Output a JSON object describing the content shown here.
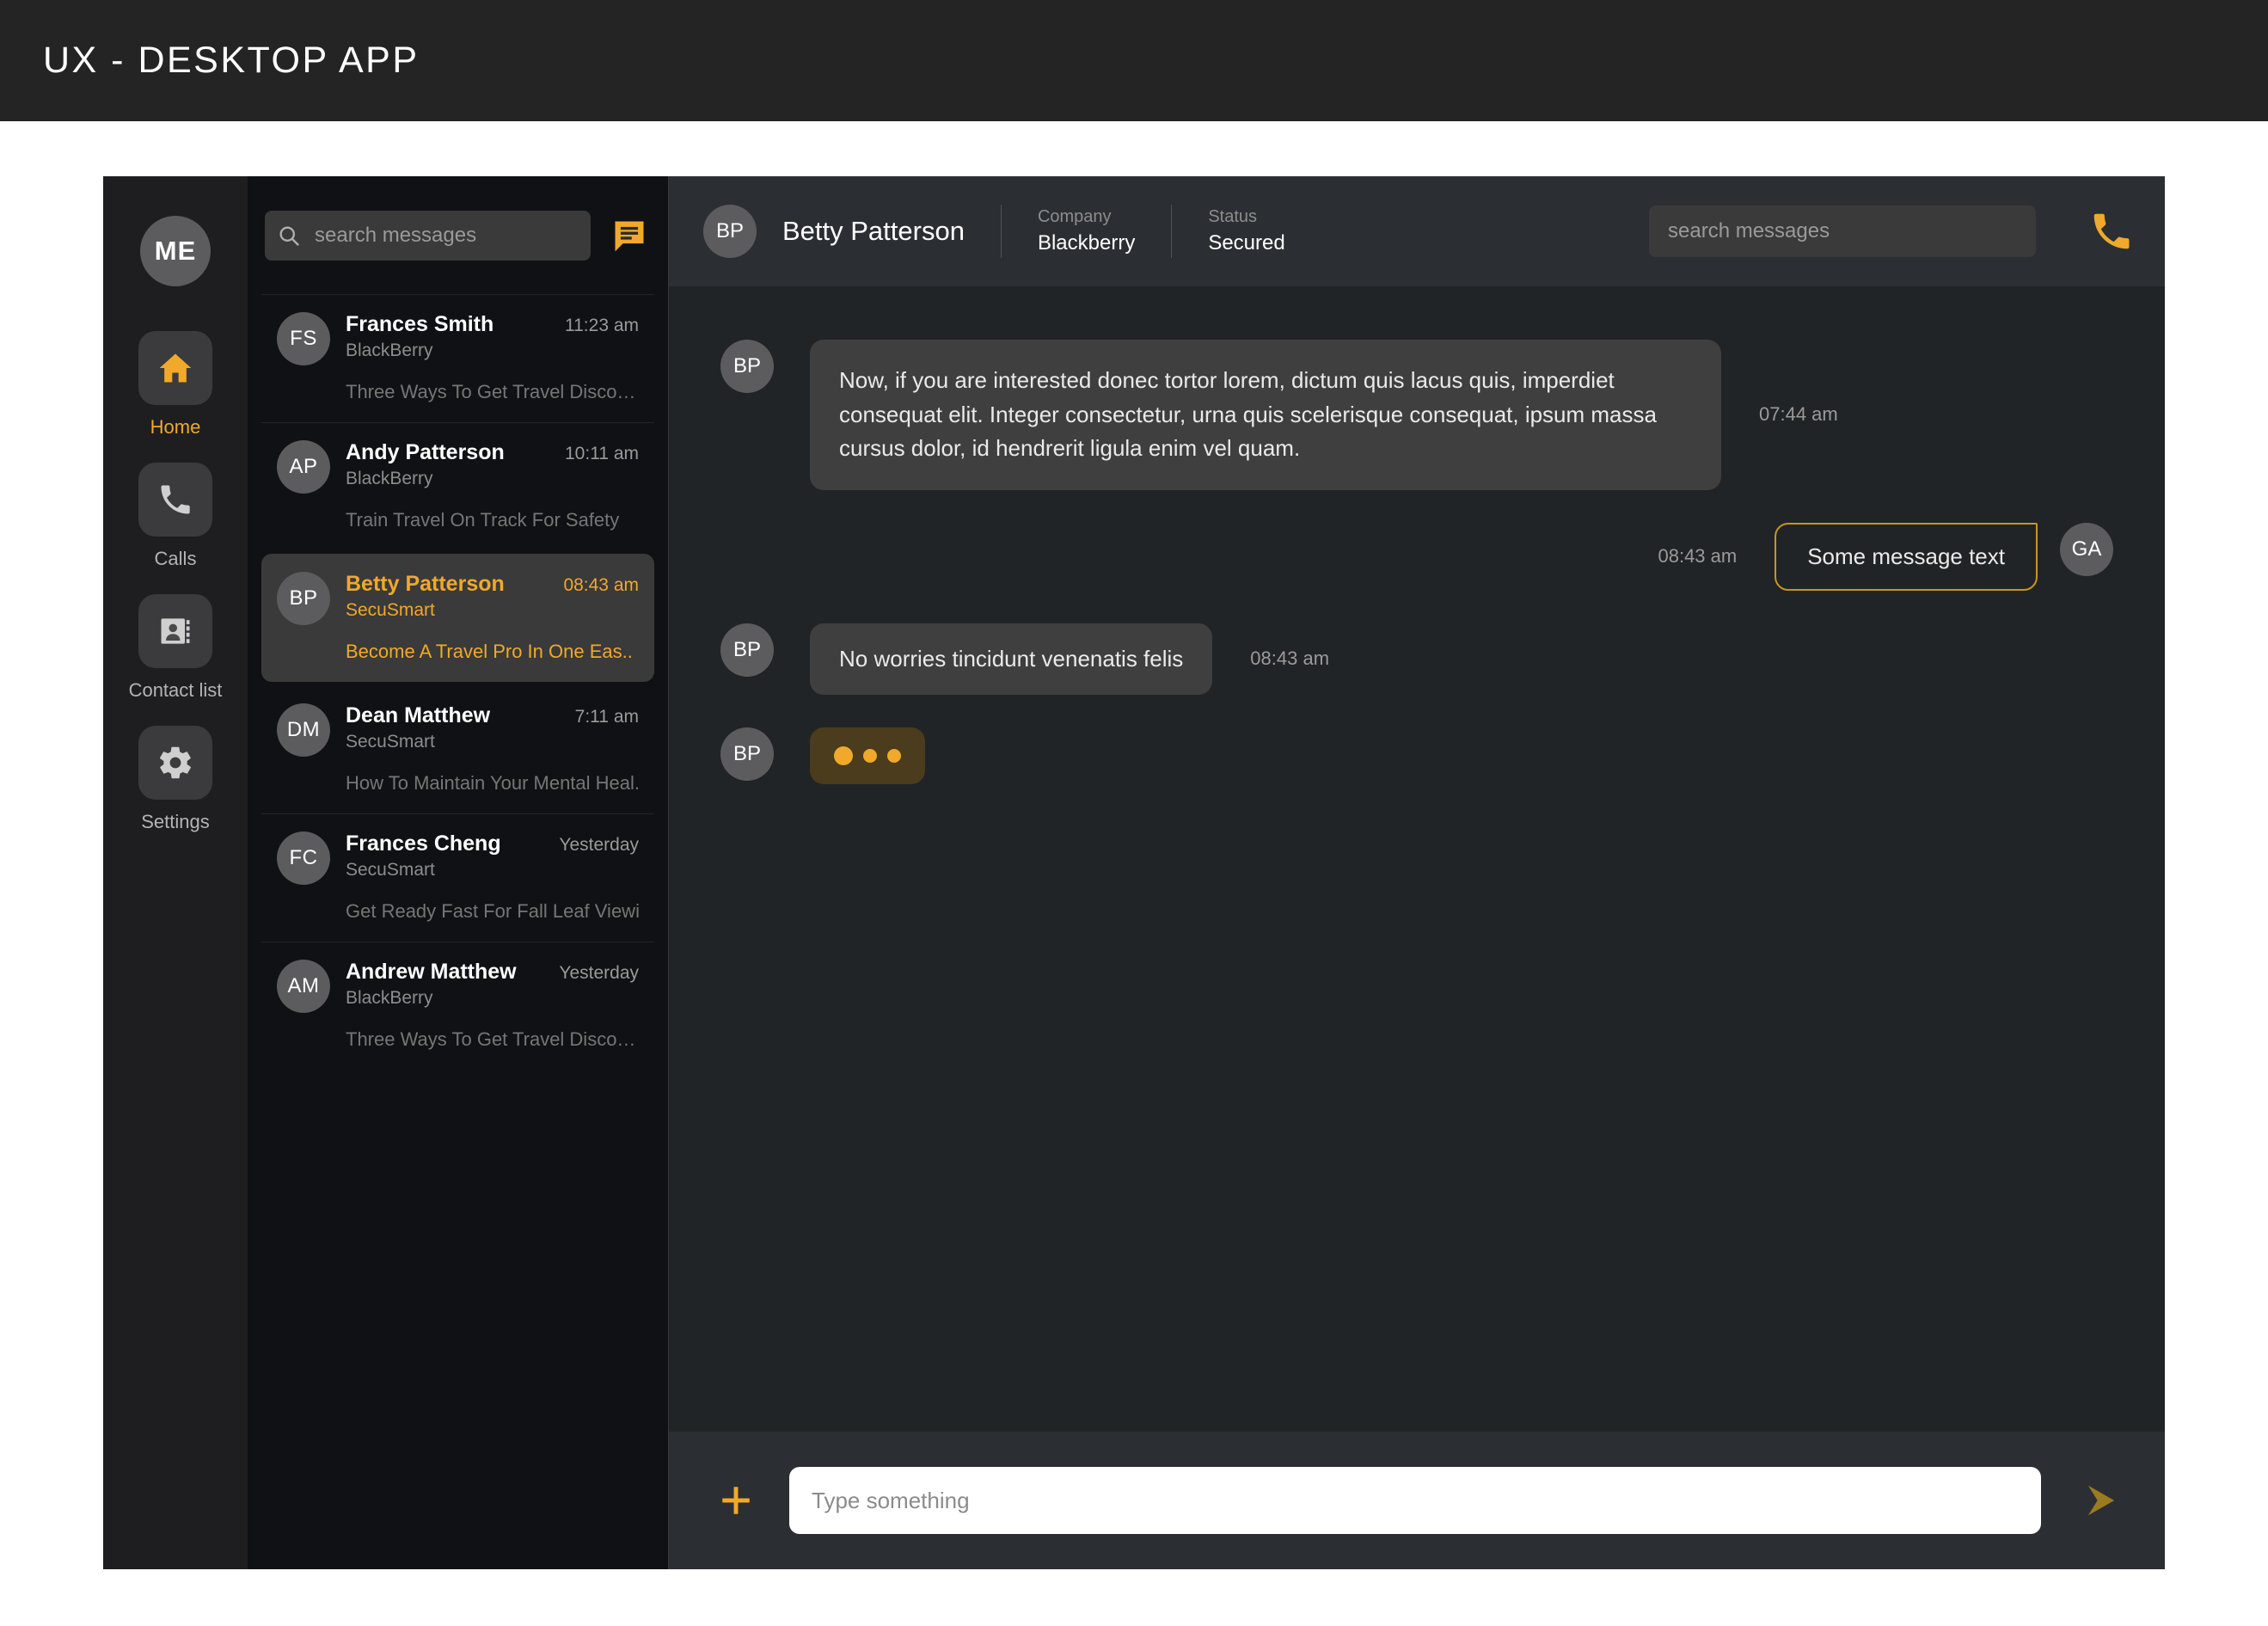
{
  "page": {
    "title": "UX - DESKTOP APP"
  },
  "colors": {
    "accent": "#f0a92b",
    "accent_dim": "#c9951f",
    "panel_dark": "#0f1114",
    "panel_mid": "#2b2f33",
    "chat_bg": "#212427",
    "tile": "#3b3b3d"
  },
  "rail": {
    "avatar_initials": "ME",
    "items": [
      {
        "label": "Home",
        "icon": "home-icon",
        "active": true
      },
      {
        "label": "Calls",
        "icon": "phone-icon",
        "active": false
      },
      {
        "label": "Contact list",
        "icon": "contact-card-icon",
        "active": false
      },
      {
        "label": "Settings",
        "icon": "gear-icon",
        "active": false
      }
    ]
  },
  "list_panel": {
    "search": {
      "placeholder": "search messages",
      "value": "",
      "icon": "search-icon"
    },
    "compose_icon": "new-message-icon",
    "conversations": [
      {
        "initials": "FS",
        "name": "Frances Smith",
        "org": "BlackBerry",
        "time": "11:23 am",
        "snippet": "Three Ways To Get Travel Disco…",
        "selected": false
      },
      {
        "initials": "AP",
        "name": "Andy Patterson",
        "org": "BlackBerry",
        "time": "10:11 am",
        "snippet": "Train Travel On Track For Safety",
        "selected": false
      },
      {
        "initials": "BP",
        "name": "Betty Patterson",
        "org": "SecuSmart",
        "time": "08:43 am",
        "snippet": "Become A Travel Pro In One Eas..",
        "selected": true
      },
      {
        "initials": "DM",
        "name": "Dean Matthew",
        "org": "SecuSmart",
        "time": "7:11 am",
        "snippet": "How To Maintain Your Mental Heal..",
        "selected": false
      },
      {
        "initials": "FC",
        "name": "Frances Cheng",
        "org": "SecuSmart",
        "time": "Yesterday",
        "snippet": "Get Ready Fast For Fall Leaf Viewi…",
        "selected": false
      },
      {
        "initials": "AM",
        "name": "Andrew Matthew",
        "org": "BlackBerry",
        "time": "Yesterday",
        "snippet": "Three Ways To Get Travel Disco…",
        "selected": false
      }
    ]
  },
  "chat_header": {
    "avatar_initials": "BP",
    "name": "Betty Patterson",
    "company_label": "Company",
    "company_value": "Blackberry",
    "status_label": "Status",
    "status_value": "Secured",
    "search": {
      "placeholder": "search messages",
      "value": ""
    },
    "call_icon": "phone-icon"
  },
  "messages": [
    {
      "direction": "in",
      "initials": "BP",
      "text": "Now, if you are interested donec tortor lorem, dictum quis lacus quis, imperdiet consequat elit. Integer consectetur, urna quis scelerisque consequat, ipsum massa cursus dolor, id hendrerit ligula enim vel quam.",
      "time": "07:44 am"
    },
    {
      "direction": "out",
      "initials": "GA",
      "text": "Some message text",
      "time": "08:43 am"
    },
    {
      "direction": "in",
      "initials": "BP",
      "text": "No worries tincidunt venenatis felis",
      "time": "08:43 am"
    },
    {
      "direction": "typing",
      "initials": "BP",
      "text": "",
      "time": ""
    }
  ],
  "composer": {
    "add_icon": "plus-icon",
    "placeholder": "Type something",
    "value": "",
    "send_icon": "send-icon"
  }
}
